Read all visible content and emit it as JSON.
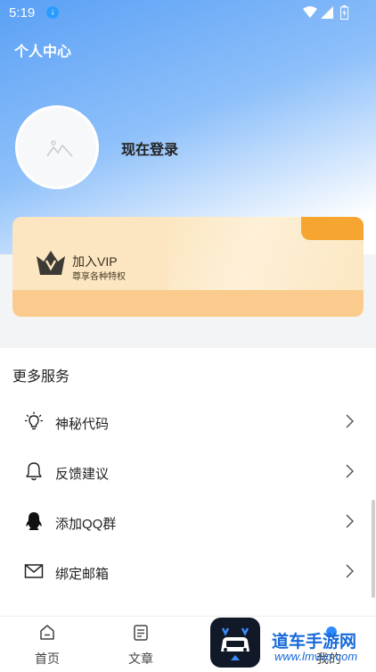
{
  "status_bar": {
    "time": "5:19"
  },
  "header": {
    "title": "个人中心"
  },
  "profile": {
    "login_text": "现在登录"
  },
  "vip": {
    "title": "加入VIP",
    "subtitle": "尊享各种特权"
  },
  "services": {
    "title": "更多服务",
    "items": [
      {
        "label": "神秘代码",
        "icon": "lightbulb-icon"
      },
      {
        "label": "反馈建议",
        "icon": "bell-icon"
      },
      {
        "label": "添加QQ群",
        "icon": "qq-penguin-icon"
      },
      {
        "label": "绑定邮箱",
        "icon": "mail-icon"
      }
    ]
  },
  "bottom_nav": {
    "items": [
      {
        "label": "首页",
        "icon": "home-icon"
      },
      {
        "label": "文章",
        "icon": "article-icon"
      },
      {
        "label": "我的",
        "icon": "user-icon"
      }
    ]
  },
  "watermark": {
    "text": "道车手游网",
    "url": "www.lmvvo.com"
  },
  "colors": {
    "accent_blue": "#5aa0f5",
    "vip_gold": "#fbe6c1",
    "vip_orange": "#f6a531"
  }
}
